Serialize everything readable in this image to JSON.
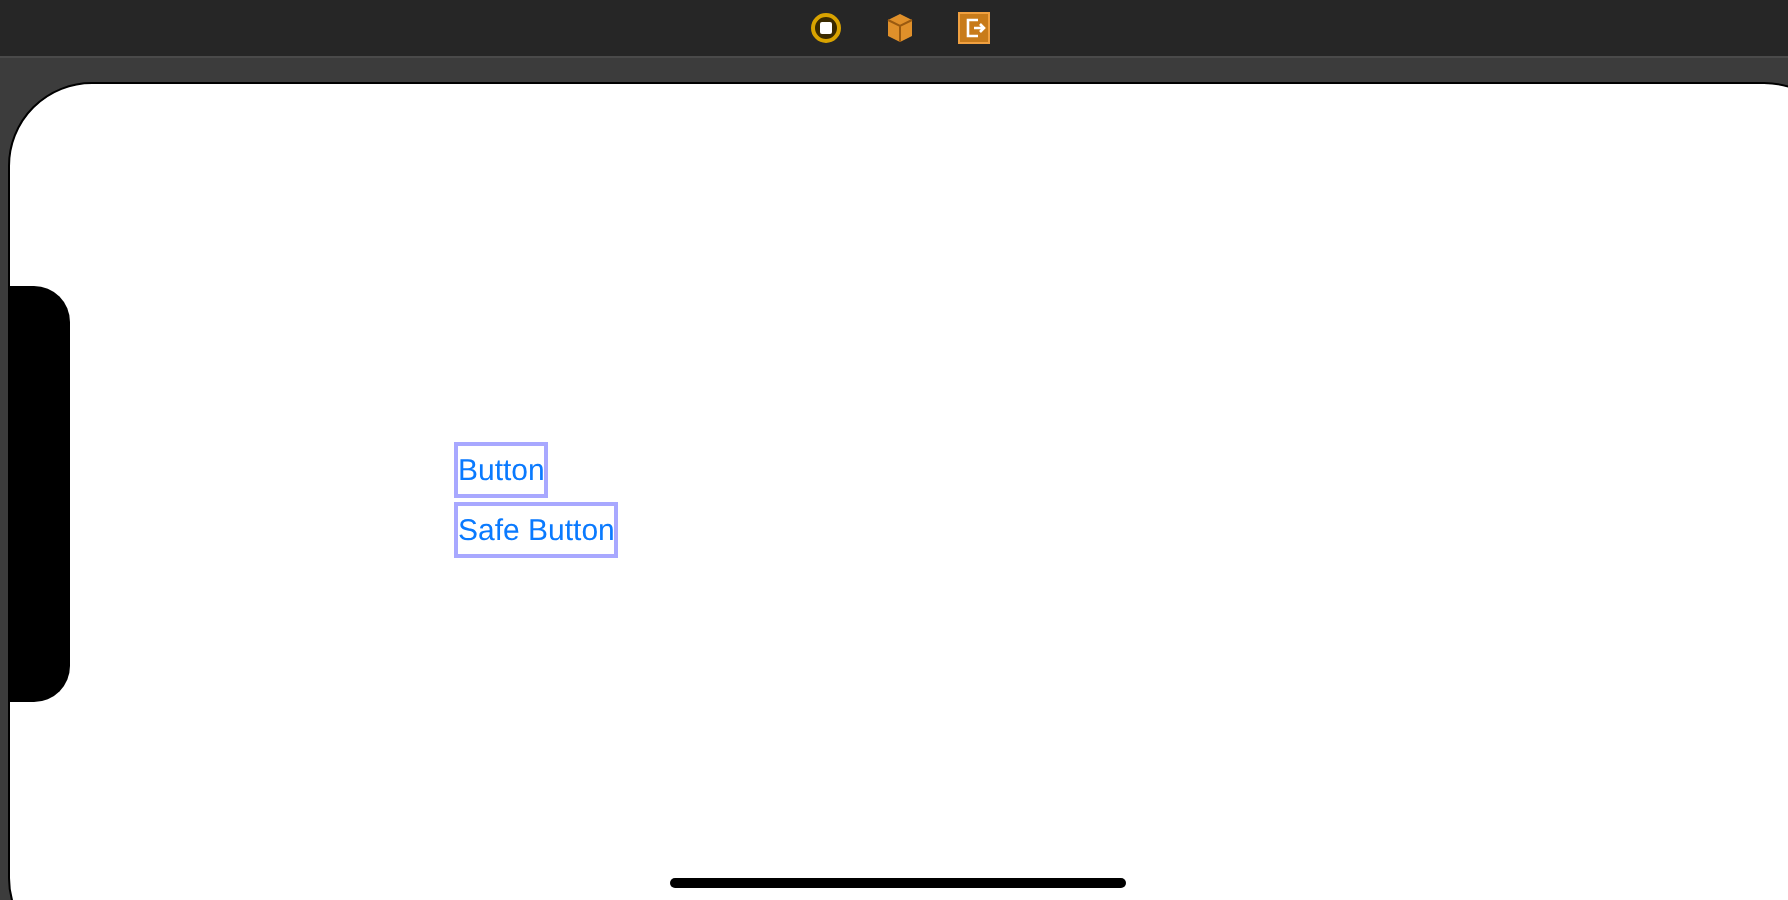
{
  "buttons": [
    {
      "label": "Button"
    },
    {
      "label": "Safe Button"
    }
  ]
}
